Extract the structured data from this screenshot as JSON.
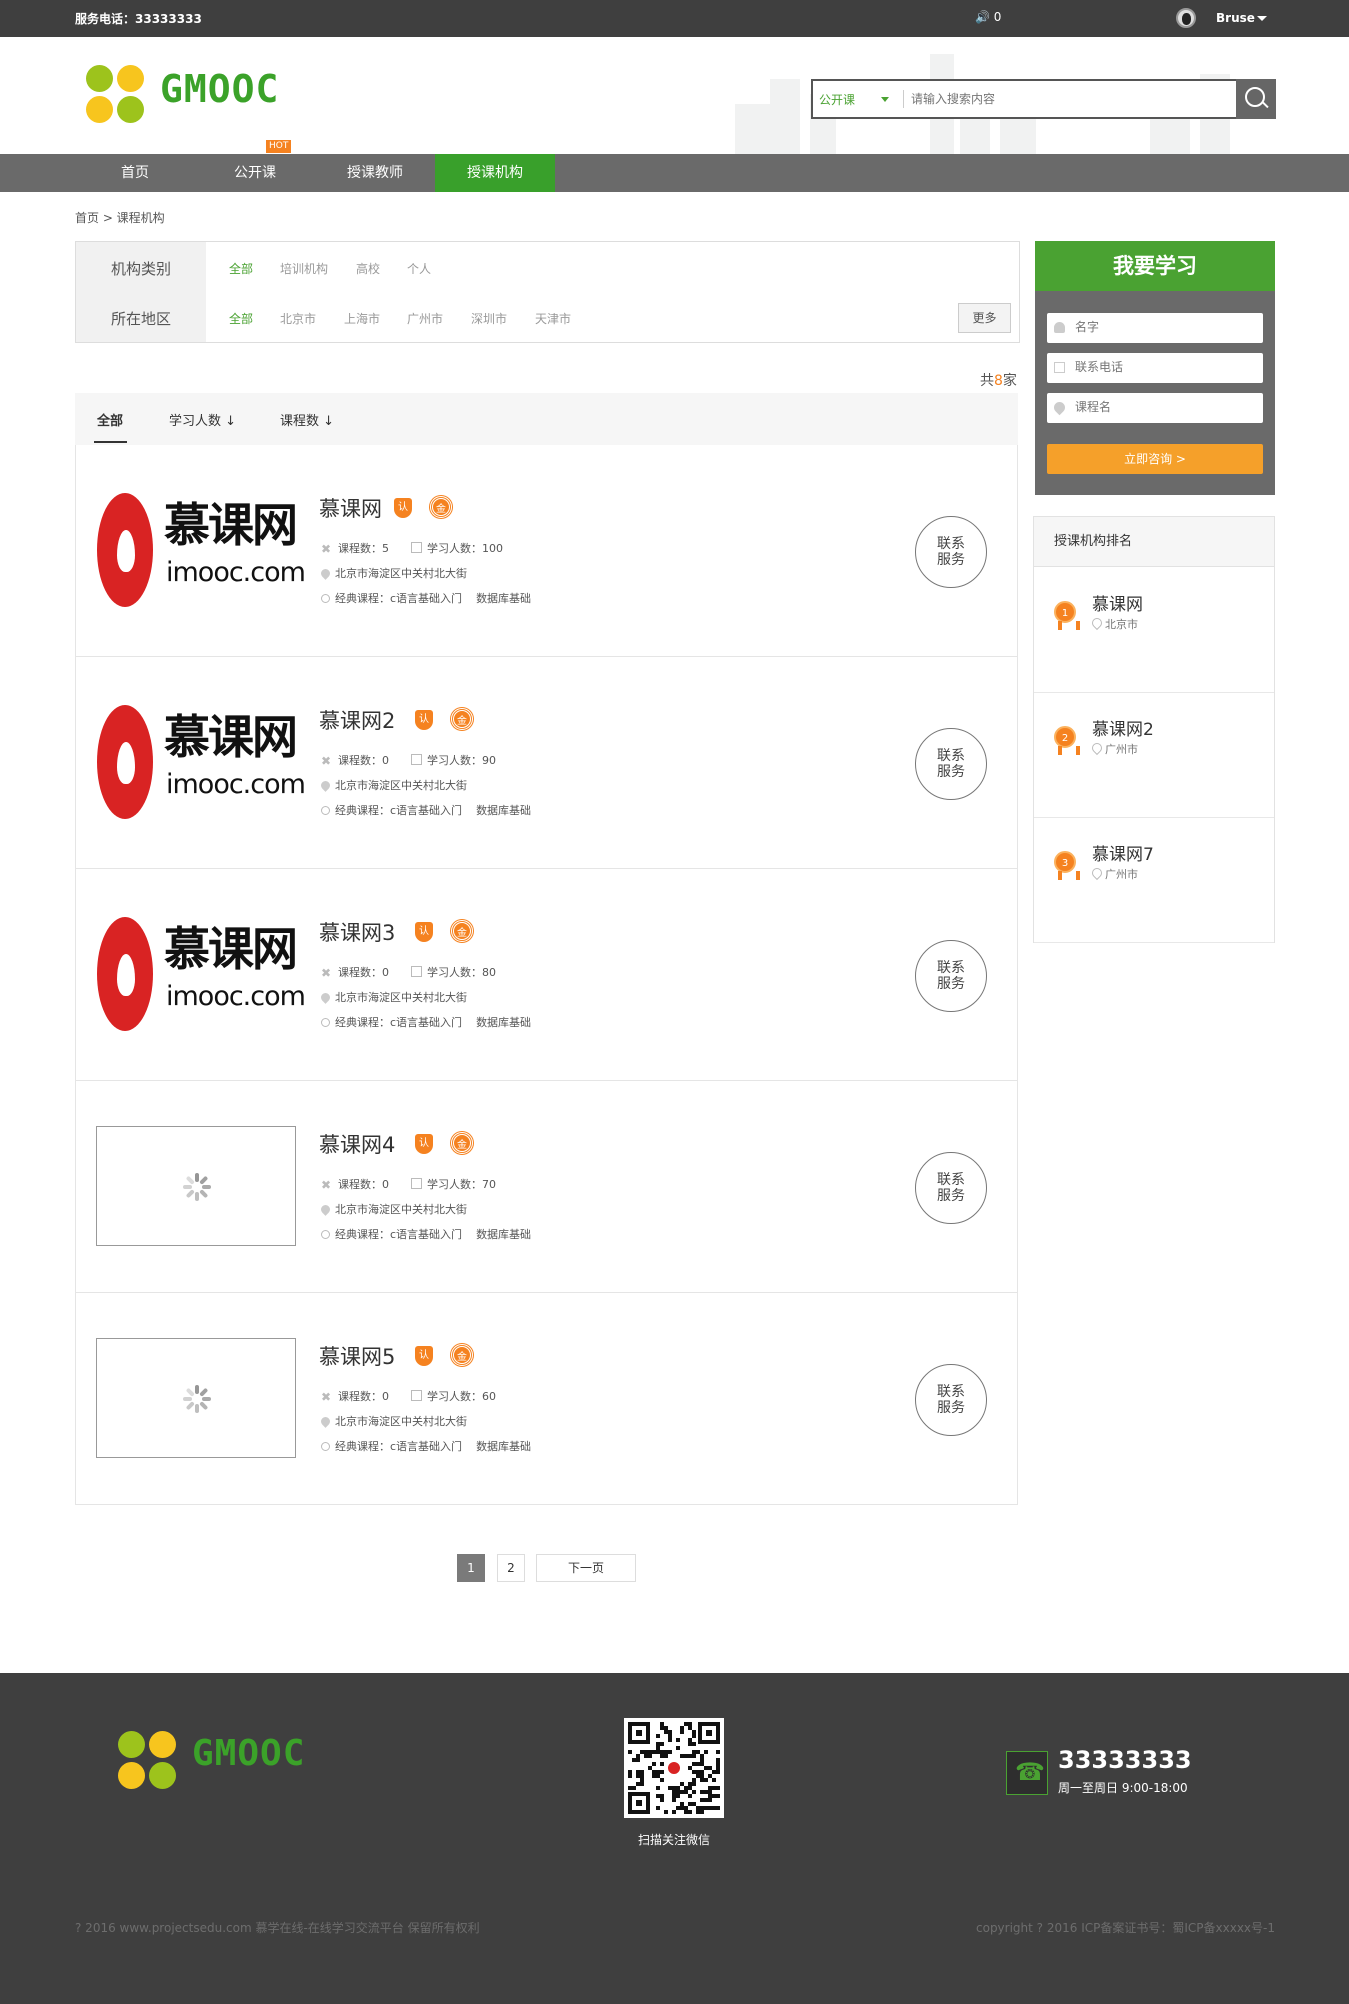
{
  "topbar": {
    "service_phone": "服务电话：33333333",
    "notification_count": "0",
    "username": "Bruse"
  },
  "brand": {
    "name": "GMOOC",
    "accent": "#3ba229",
    "nav_bg": "#6a6a6a",
    "orange": "#f58220"
  },
  "search": {
    "category": "公开课",
    "placeholder": "请输入搜索内容"
  },
  "nav": {
    "items": [
      {
        "label": "首页"
      },
      {
        "label": "公开课"
      },
      {
        "label": "授课教师"
      },
      {
        "label": "授课机构"
      }
    ],
    "hot_tag": "HOT",
    "active": "授课机构"
  },
  "breadcrumb": "首页 > 课程机构",
  "filter": {
    "type_label": "机构类别",
    "type_options": [
      "全部",
      "培训机构",
      "高校",
      "个人"
    ],
    "region_label": "所在地区",
    "region_options": [
      "全部",
      "北京市",
      "上海市",
      "广州市",
      "深圳市",
      "天津市"
    ],
    "more": "更多"
  },
  "total": {
    "prefix": "共",
    "count": "8",
    "suffix": "家"
  },
  "sort": {
    "all": "全部",
    "students": "学习人数 ↓",
    "courses": "课程数 ↓"
  },
  "org_labels": {
    "courses": "课程数：",
    "students": "学习人数：",
    "classic": "经典课程：",
    "contact_line1": "联系",
    "contact_line2": "服务",
    "badge_cert": "认",
    "badge_gold": "金"
  },
  "orgs": [
    {
      "name": "慕课网",
      "courses": "5",
      "students": "100",
      "address": "北京市海淀区中关村北大街",
      "classic": [
        "c语言基础入门",
        "数据库基础"
      ],
      "logo": "imooc"
    },
    {
      "name": "慕课网2",
      "courses": "0",
      "students": "90",
      "address": "北京市海淀区中关村北大街",
      "classic": [
        "c语言基础入门",
        "数据库基础"
      ],
      "logo": "imooc"
    },
    {
      "name": "慕课网3",
      "courses": "0",
      "students": "80",
      "address": "北京市海淀区中关村北大街",
      "classic": [
        "c语言基础入门",
        "数据库基础"
      ],
      "logo": "imooc"
    },
    {
      "name": "慕课网4",
      "courses": "0",
      "students": "70",
      "address": "北京市海淀区中关村北大街",
      "classic": [
        "c语言基础入门",
        "数据库基础"
      ],
      "logo": "loading"
    },
    {
      "name": "慕课网5",
      "courses": "0",
      "students": "60",
      "address": "北京市海淀区中关村北大街",
      "classic": [
        "c语言基础入门",
        "数据库基础"
      ],
      "logo": "loading"
    }
  ],
  "imooc_logo": {
    "cn": "慕课网",
    "en": "imooc.com"
  },
  "pagination": {
    "pages": [
      "1",
      "2"
    ],
    "current": "1",
    "next": "下一页"
  },
  "learn_form": {
    "title": "我要学习",
    "name_placeholder": "名字",
    "phone_placeholder": "联系电话",
    "course_placeholder": "课程名",
    "submit": "立即咨询 >"
  },
  "ranking": {
    "title": "授课机构排名",
    "items": [
      {
        "rank": "1",
        "name": "慕课网",
        "city": "北京市"
      },
      {
        "rank": "2",
        "name": "慕课网2",
        "city": "广州市"
      },
      {
        "rank": "3",
        "name": "慕课网7",
        "city": "广州市"
      }
    ]
  },
  "footer": {
    "qr_label": "扫描关注微信",
    "phone": "33333333",
    "hours": "周一至周日 9:00-18:00",
    "copyright_left": "? 2016 www.projectsedu.com 慕学在线-在线学习交流平台 保留所有权利",
    "copyright_right": "copyright ? 2016 ICP备案证书号：蜀ICP备xxxxx号-1"
  }
}
